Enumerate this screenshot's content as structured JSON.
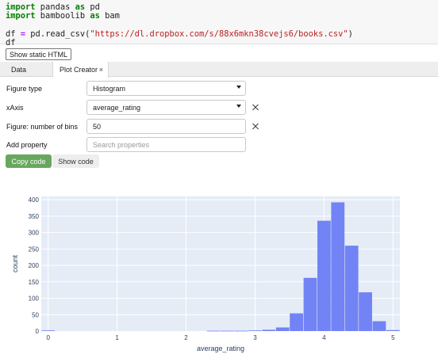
{
  "code": {
    "line1": {
      "kw": "import",
      "mod": " pandas ",
      "as": "as",
      "alias": " pd"
    },
    "line2": {
      "kw": "import",
      "mod": " bamboolib ",
      "as": "as",
      "alias": " bam"
    },
    "line3": {
      "lhs": "df ",
      "eq": "=",
      "call": " pd.read_csv(",
      "str": "\"https://dl.dropbox.com/s/88x6mkn38cvejs6/books.csv\"",
      "close": ")"
    },
    "line4": "df"
  },
  "static_button": "Show static HTML",
  "tabs": [
    {
      "label": "Data"
    },
    {
      "label": "Plot Creator",
      "close": "×"
    }
  ],
  "form": {
    "figure_type": {
      "label": "Figure type",
      "value": "Histogram"
    },
    "xaxis": {
      "label": "xAxis",
      "value": "average_rating"
    },
    "bins": {
      "label": "Figure: number of bins",
      "value": "50"
    },
    "add_property": {
      "label": "Add property",
      "placeholder": "Search properties"
    }
  },
  "buttons": {
    "copy": "Copy code",
    "show": "Show code"
  },
  "colors": {
    "bar": "#7283f5",
    "plot_bg": "#e5ecf6",
    "copy_button": "#68a85e"
  },
  "chart_data": {
    "type": "bar",
    "xlabel": "average_rating",
    "ylabel": "count",
    "x_range": [
      -0.1,
      5.1
    ],
    "ylim": [
      0,
      410
    ],
    "x_ticks": [
      0,
      1,
      2,
      3,
      4,
      5
    ],
    "y_ticks": [
      0,
      50,
      100,
      150,
      200,
      250,
      300,
      350,
      400
    ],
    "bin_width": 0.2,
    "bins": [
      {
        "x0": -0.1,
        "count": 2
      },
      {
        "x0": 2.3,
        "count": 1
      },
      {
        "x0": 2.5,
        "count": 1
      },
      {
        "x0": 2.7,
        "count": 1
      },
      {
        "x0": 2.9,
        "count": 2
      },
      {
        "x0": 3.1,
        "count": 4
      },
      {
        "x0": 3.3,
        "count": 11
      },
      {
        "x0": 3.5,
        "count": 54
      },
      {
        "x0": 3.7,
        "count": 162
      },
      {
        "x0": 3.9,
        "count": 336
      },
      {
        "x0": 4.1,
        "count": 392
      },
      {
        "x0": 4.3,
        "count": 260
      },
      {
        "x0": 4.5,
        "count": 118
      },
      {
        "x0": 4.7,
        "count": 30
      },
      {
        "x0": 4.9,
        "count": 3
      }
    ]
  }
}
